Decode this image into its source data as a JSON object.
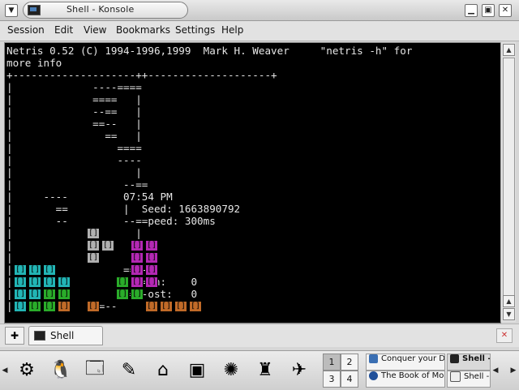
{
  "window": {
    "title": "Shell - Konsole"
  },
  "menubar": {
    "items": [
      "Session",
      "Edit",
      "View",
      "Bookmarks",
      "Settings",
      "Help"
    ]
  },
  "terminal": {
    "lines": [
      "Netris 0.52 (C) 1994-1996,1999  Mark H. Weaver     \"netris -h\" for",
      "more info",
      "+--------------------++--------------------+",
      "|             ----====                      ",
      "|             ====   |                      ",
      "|             --==   |                      ",
      "|             ==--   |                      ",
      "|               ==   |                      ",
      "|                 ====                      ",
      "|                 ----                      ",
      "|                    |                      ",
      "|                  --==                     ",
      "|     ----         07:54 PM                 ",
      "|       ==         |  Seed: 1663890792      ",
      "|       --         --==peed: 300ms          ",
      "|                    |                      ",
      "|            --      |                      ",
      "|                    |                      ",
      "|                  ==--                     ",
      "|                  --==on:    0             ",
      "|                  ==--ost:   0             ",
      "|             ==--                          "
    ]
  },
  "tabs": {
    "items": [
      {
        "label": "Shell"
      }
    ]
  },
  "taskbar": {
    "pager": [
      "1",
      "2",
      "3",
      "4"
    ],
    "tasks": [
      {
        "label": "Conquer your D"
      },
      {
        "label": "The Book of Mo"
      },
      {
        "label": "Shell -"
      },
      {
        "label": "Shell -"
      }
    ]
  },
  "colors": {
    "terminal_bg": "#000000",
    "terminal_fg": "#e6e6e6",
    "cyan": "#22b5b5",
    "green": "#2aac2a",
    "orange": "#c06a28",
    "magenta": "#b428b4",
    "grey": "#b0b0b0"
  }
}
